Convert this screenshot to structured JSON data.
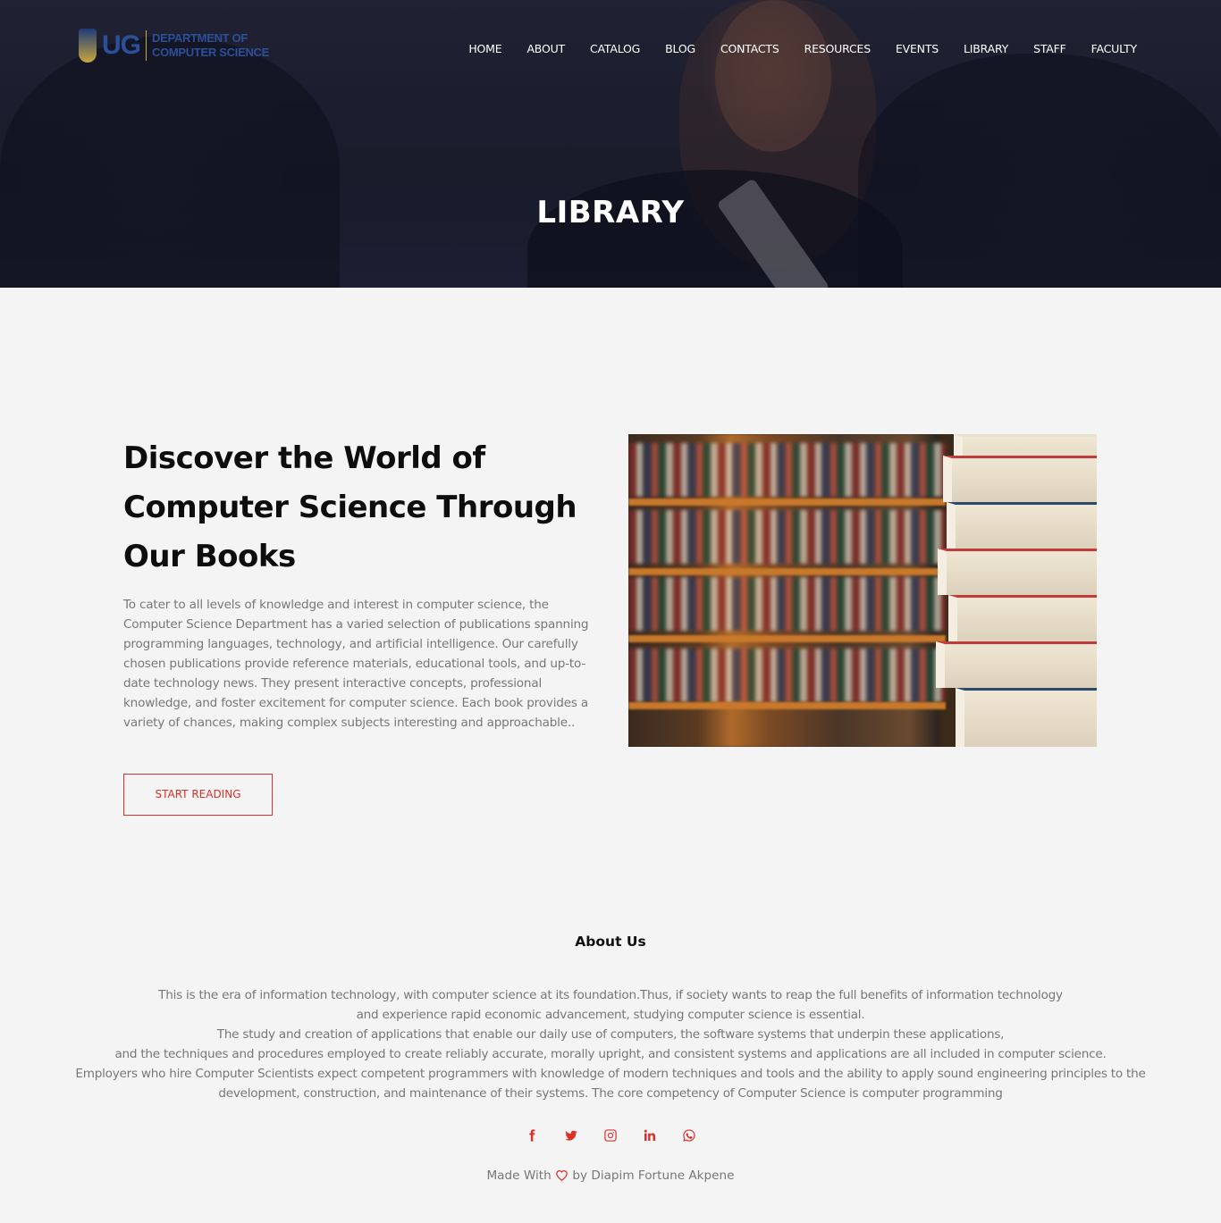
{
  "logo": {
    "short": "UG",
    "line1": "DEPARTMENT OF",
    "line2": "COMPUTER SCIENCE"
  },
  "nav": [
    "HOME",
    "ABOUT",
    "CATALOG",
    "BLOG",
    "CONTACTS",
    "RESOURCES",
    "EVENTS",
    "LIBRARY",
    "STAFF",
    "FACULTY"
  ],
  "hero": {
    "title": "LIBRARY"
  },
  "main": {
    "heading_lines": [
      "Discover the World of",
      "Computer Science Through",
      "Our Books"
    ],
    "body": "To cater to all levels of knowledge and interest in computer science, the Computer Science Department has a varied selection of publications spanning programming languages, technology, and artificial intelligence. Our carefully chosen publications provide reference materials, educational tools, and up-to-date technology news. They present interactive concepts, professional knowledge, and foster excitement for computer science. Each book provides a variety of chances, making complex subjects interesting and approachable..",
    "button_label": "START READING"
  },
  "about": {
    "title": "About Us",
    "lines": [
      "This is the era of information technology, with computer science at its foundation.Thus, if society wants to reap the full benefits of information technology",
      "and experience rapid economic advancement, studying computer science is essential.",
      "The study and creation of applications that enable our daily use of computers, the software systems that underpin these applications,",
      "and the techniques and procedures employed to create reliably accurate, morally upright, and consistent systems and applications are all included in computer science.",
      "Employers who hire Computer Scientists expect competent programmers with knowledge of modern techniques and tools and the ability to apply sound engineering principles to the",
      "development, construction, and maintenance of their systems. The core competency of Computer Science is computer programming"
    ]
  },
  "socials": [
    "facebook-icon",
    "twitter-icon",
    "instagram-icon",
    "linkedin-icon",
    "whatsapp-icon"
  ],
  "footer": {
    "made_with": "Made With",
    "by": "by Diapim Fortune Akpene"
  },
  "colors": {
    "accent": "#d9302a",
    "background": "#f4f4f4",
    "muted_text": "#777777"
  }
}
